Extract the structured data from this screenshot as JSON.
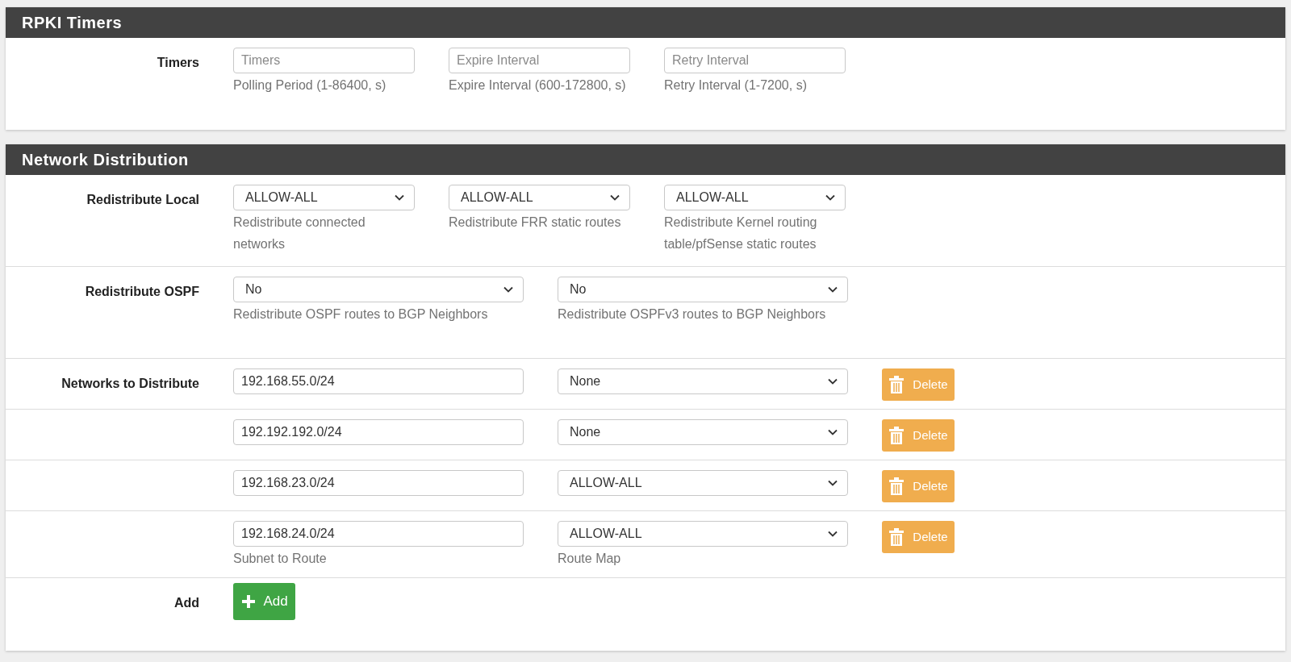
{
  "sections": [
    {
      "title": "RPKI Timers",
      "rows": [
        {
          "kind": "triple",
          "label": "Timers",
          "cells": [
            {
              "kind": "input",
              "placeholder": "Timers",
              "help": "Polling Period (1-86400, s)"
            },
            {
              "kind": "input",
              "placeholder": "Expire Interval",
              "help": "Expire Interval (600-172800, s)"
            },
            {
              "kind": "input",
              "placeholder": "Retry Interval",
              "help": "Retry Interval (1-7200, s)"
            }
          ]
        }
      ]
    },
    {
      "title": "Network Distribution",
      "rows": [
        {
          "kind": "triple",
          "label": "Redistribute Local",
          "cells": [
            {
              "kind": "select",
              "value": "ALLOW-ALL",
              "help": "Redistribute connected networks"
            },
            {
              "kind": "select",
              "value": "ALLOW-ALL",
              "help": "Redistribute FRR static routes"
            },
            {
              "kind": "select",
              "value": "ALLOW-ALL",
              "help": "Redistribute Kernel routing table/pfSense static routes"
            }
          ]
        },
        {
          "kind": "double",
          "label": "Redistribute OSPF",
          "cells": [
            {
              "kind": "select",
              "value": "No",
              "help": "Redistribute OSPF routes to BGP Neighbors"
            },
            {
              "kind": "select",
              "value": "No",
              "help": "Redistribute OSPFv3 routes to BGP Neighbors"
            }
          ]
        },
        {
          "kind": "network",
          "label": "Networks to Distribute",
          "cells": [
            {
              "kind": "input",
              "value": "192.168.55.0/24"
            },
            {
              "kind": "select",
              "value": "None"
            },
            {
              "kind": "delete",
              "label": "Delete"
            }
          ]
        },
        {
          "kind": "network",
          "cells": [
            {
              "kind": "input",
              "value": "192.192.192.0/24"
            },
            {
              "kind": "select",
              "value": "None"
            },
            {
              "kind": "delete",
              "label": "Delete"
            }
          ]
        },
        {
          "kind": "network",
          "cells": [
            {
              "kind": "input",
              "value": "192.168.23.0/24"
            },
            {
              "kind": "select",
              "value": "ALLOW-ALL"
            },
            {
              "kind": "delete",
              "label": "Delete"
            }
          ]
        },
        {
          "kind": "network",
          "cells": [
            {
              "kind": "input",
              "value": "192.168.24.0/24",
              "help": "Subnet to Route"
            },
            {
              "kind": "select",
              "value": "ALLOW-ALL",
              "help": "Route Map"
            },
            {
              "kind": "delete",
              "label": "Delete"
            }
          ]
        },
        {
          "kind": "add",
          "label": "Add",
          "cells": [
            {
              "kind": "add",
              "label": "Add"
            }
          ]
        }
      ]
    }
  ]
}
